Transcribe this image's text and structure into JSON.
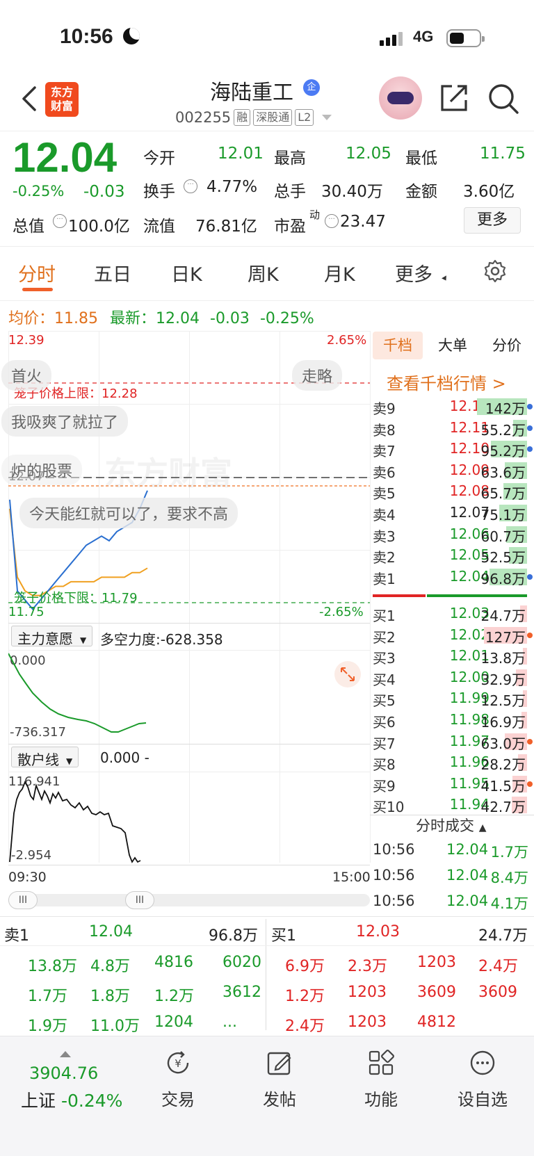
{
  "status_bar": {
    "time": "10:56",
    "network": "4G"
  },
  "header": {
    "logo_line1": "东方",
    "logo_line2": "财富",
    "stock_name": "海陆重工",
    "badge": "企",
    "code": "002255",
    "tags": [
      "融",
      "深股通",
      "L2"
    ]
  },
  "quote": {
    "price": "12.04",
    "change_pct": "-0.25%",
    "change": "-0.03",
    "open_label": "今开",
    "open": "12.01",
    "high_label": "最高",
    "high": "12.05",
    "low_label": "最低",
    "low": "11.75",
    "turnover_label": "换手",
    "turnover": "4.77%",
    "volume_label": "总手",
    "volume": "30.40万",
    "amount_label": "金额",
    "amount": "3.60亿",
    "mktcap_label": "总值",
    "mktcap": "100.0亿",
    "float_label": "流值",
    "float": "76.81亿",
    "pe_label": "市盈",
    "pe_sup": "动",
    "pe": "23.47",
    "more_button": "更多"
  },
  "tabs": [
    "分时",
    "五日",
    "日K",
    "周K",
    "月K",
    "更多"
  ],
  "avg_line": {
    "avg_label": "均价：",
    "avg": "11.85",
    "latest_label": "最新：",
    "latest": "12.04",
    "chg": "-0.03",
    "pct": "-0.25%"
  },
  "chart": {
    "y_top": "12.39",
    "y_top_pct": "2.65%",
    "y_mid": "12.07",
    "y_bot": "11.75",
    "y_bot_pct": "-2.65%",
    "cage_upper": "笼子价格上限：12.28",
    "cage_lower": "笼子价格下限：11.79",
    "watermark": "东方财富",
    "bubbles": [
      "首火",
      "走略",
      "我吸爽了就拉了",
      "炉的股票",
      "今天能红就可以了，要求不高"
    ],
    "ind1_name": "主力意愿",
    "ind1_text": "多空力度:-628.358",
    "ind1_top": "0.000",
    "ind1_bot": "-736.317",
    "ind2_name": "散户线",
    "ind2_text": "0.000 -",
    "ind2_top": "116.941",
    "ind2_bot": "-2.954",
    "t_start": "09:30",
    "t_end": "15:00",
    "handle_label": "III"
  },
  "chart_data": {
    "type": "line",
    "title": "",
    "x_range": [
      "09:30",
      "15:00"
    ],
    "ylim": [
      11.75,
      12.39
    ],
    "series": [
      {
        "name": "",
        "color": "#2a6fd0",
        "values": [
          12.02,
          11.82,
          11.8,
          11.78,
          11.8,
          11.82,
          11.84,
          11.86,
          11.88,
          11.9,
          11.92,
          11.93,
          11.94,
          11.93,
          11.95,
          11.96,
          11.97,
          12.0,
          12.04
        ]
      },
      {
        "name": "",
        "color": "#f0a020",
        "values": [
          12.0,
          11.85,
          11.82,
          11.81,
          11.81,
          11.82,
          11.83,
          11.83,
          11.84,
          11.84,
          11.84,
          11.84,
          11.85,
          11.85,
          11.85,
          11.85,
          11.86,
          11.86,
          11.87
        ]
      }
    ]
  },
  "orderbook": {
    "tabs": [
      "千档",
      "大单",
      "分价"
    ],
    "link": "查看千档行情 >",
    "sells": [
      {
        "n": "卖9",
        "p": "12.12",
        "v": "142万",
        "dot": "#3a6fd8",
        "bar": 0.9
      },
      {
        "n": "卖8",
        "p": "12.11",
        "v": "55.2万",
        "dot": "#3a6fd8",
        "bar": 0.25
      },
      {
        "n": "卖7",
        "p": "12.10",
        "v": "95.2万",
        "dot": "#3a6fd8",
        "bar": 0.65
      },
      {
        "n": "卖6",
        "p": "12.09",
        "v": "63.6万",
        "dot": "",
        "bar": 0.4
      },
      {
        "n": "卖5",
        "p": "12.08",
        "v": "65.7万",
        "dot": "",
        "bar": 0.42
      },
      {
        "n": "卖4",
        "p": "12.07",
        "v": "75.1万",
        "dot": "",
        "bar": 0.5
      },
      {
        "n": "卖3",
        "p": "12.06",
        "v": "60.7万",
        "dot": "",
        "bar": 0.38
      },
      {
        "n": "卖2",
        "p": "12.05",
        "v": "52.5万",
        "dot": "",
        "bar": 0.32
      },
      {
        "n": "卖1",
        "p": "12.04",
        "v": "96.8万",
        "dot": "#3a6fd8",
        "bar": 0.68
      }
    ],
    "buys": [
      {
        "n": "买1",
        "p": "12.03",
        "v": "24.7万",
        "dot": "",
        "bar": 0.12
      },
      {
        "n": "买2",
        "p": "12.02",
        "v": "127万",
        "dot": "#f0602a",
        "bar": 0.78
      },
      {
        "n": "买3",
        "p": "12.01",
        "v": "13.8万",
        "dot": "",
        "bar": 0.08
      },
      {
        "n": "买4",
        "p": "12.00",
        "v": "32.9万",
        "dot": "",
        "bar": 0.2
      },
      {
        "n": "买5",
        "p": "11.99",
        "v": "12.5万",
        "dot": "",
        "bar": 0.08
      },
      {
        "n": "买6",
        "p": "11.98",
        "v": "16.9万",
        "dot": "",
        "bar": 0.1
      },
      {
        "n": "买7",
        "p": "11.97",
        "v": "63.0万",
        "dot": "#f0602a",
        "bar": 0.4
      },
      {
        "n": "买8",
        "p": "11.96",
        "v": "28.2万",
        "dot": "",
        "bar": 0.16
      },
      {
        "n": "买9",
        "p": "11.95",
        "v": "41.5万",
        "dot": "#f0602a",
        "bar": 0.26
      },
      {
        "n": "买10",
        "p": "11.94",
        "v": "42.7万",
        "dot": "",
        "bar": 0.27
      }
    ],
    "ticks_title": "分时成交",
    "ticks": [
      {
        "t": "10:56",
        "p": "12.04",
        "v": "1.7万"
      },
      {
        "t": "10:56",
        "p": "12.04",
        "v": "8.4万"
      },
      {
        "t": "10:56",
        "p": "12.04",
        "v": "4.1万"
      }
    ]
  },
  "bottom": {
    "left_head": [
      "卖1",
      "12.04",
      "96.8万"
    ],
    "right_head": [
      "买1",
      "12.03",
      "24.7万"
    ],
    "left_rows": [
      [
        "13.8万",
        "4.8万",
        "4816",
        "6020"
      ],
      [
        "1.7万",
        "1.8万",
        "1.2万",
        "3612"
      ],
      [
        "1.9万",
        "11.0万",
        "1204",
        "..."
      ]
    ],
    "right_rows": [
      [
        "6.9万",
        "2.3万",
        "1203",
        "2.4万"
      ],
      [
        "1.2万",
        "1203",
        "3609",
        "3609"
      ],
      [
        "2.4万",
        "1203",
        "4812",
        ""
      ]
    ]
  },
  "footer": {
    "index_value": "3904.76",
    "index_name": "上证",
    "index_pct": "-0.24%",
    "buttons": [
      "交易",
      "发帖",
      "功能",
      "设自选"
    ]
  },
  "colors": {
    "red": "#e02424",
    "green": "#1a9a2a",
    "orange": "#e0701c",
    "blue": "#2a6fd0"
  }
}
